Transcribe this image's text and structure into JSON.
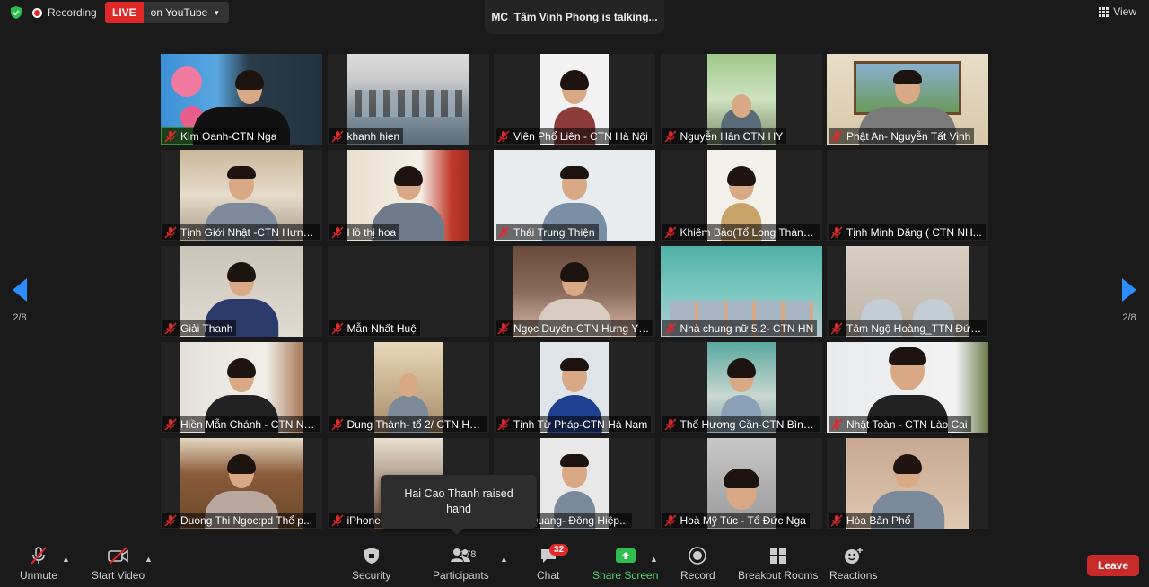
{
  "top_bar": {
    "recording_label": "Recording",
    "live_label": "LIVE",
    "live_target": "on YouTube",
    "talking_text": "MC_Tâm Vinh Phong is talking...",
    "view_label": "View"
  },
  "navigation": {
    "left_page": "2/8",
    "right_page": "2/8"
  },
  "participants_grid": [
    {
      "name": "Kim Oanh-CTN Nga"
    },
    {
      "name": "khanh hien"
    },
    {
      "name": "Viên Phổ Liên - CTN Hà Nội"
    },
    {
      "name": "Nguyễn Hân CTN HY"
    },
    {
      "name": "Phật An- Nguyễn Tất Vinh"
    },
    {
      "name": "Tịnh Giới Nhật -CTN Hưng ..."
    },
    {
      "name": "Hồ thị hoa"
    },
    {
      "name": "Thái Trung Thiện"
    },
    {
      "name": "Khiêm Bảo(Tổ Long Thành-..."
    },
    {
      "name": "Tịnh Minh Đăng ( CTN NH..."
    },
    {
      "name": "Giải Thanh"
    },
    {
      "name": "Mẫn Nhất Huệ"
    },
    {
      "name": "Ngọc Duyên-CTN Hưng Yên"
    },
    {
      "name": "Nhà chung nữ 5.2- CTN HN"
    },
    {
      "name": "Tâm Ngộ Hoàng_TTN Đức ..."
    },
    {
      "name": "Hiền Mẫn Chánh - CTN Nh..."
    },
    {
      "name": "Dung Thành- tổ 2/ CTN Hà..."
    },
    {
      "name": "Tịnh Từ Pháp-CTN Hà Nam"
    },
    {
      "name": "Thể Hương Cần-CTN Bình ..."
    },
    {
      "name": "Nhật Toàn - CTN Lào Cai"
    },
    {
      "name": "Duong Thi Ngoc:pd Thể p..."
    },
    {
      "name": "iPhone"
    },
    {
      "name": "Ân Quang- Đông Hiệp..."
    },
    {
      "name": "Hoà Mỹ Túc - Tổ Đức Nga"
    },
    {
      "name": "Hòa Bản Phổ"
    }
  ],
  "toast": {
    "text": "Hai Cao Thanh raised hand"
  },
  "toolbar": {
    "unmute": "Unmute",
    "start_video": "Start Video",
    "security": "Security",
    "participants": "Participants",
    "participants_count": "178",
    "chat": "Chat",
    "chat_badge": "32",
    "share_screen": "Share Screen",
    "record": "Record",
    "breakout_rooms": "Breakout Rooms",
    "reactions": "Reactions",
    "leave": "Leave"
  },
  "colors": {
    "live_red": "#e02828",
    "share_green": "#4cd964",
    "leave_red": "#c82a2a",
    "arrow_blue": "#2d8cff"
  }
}
